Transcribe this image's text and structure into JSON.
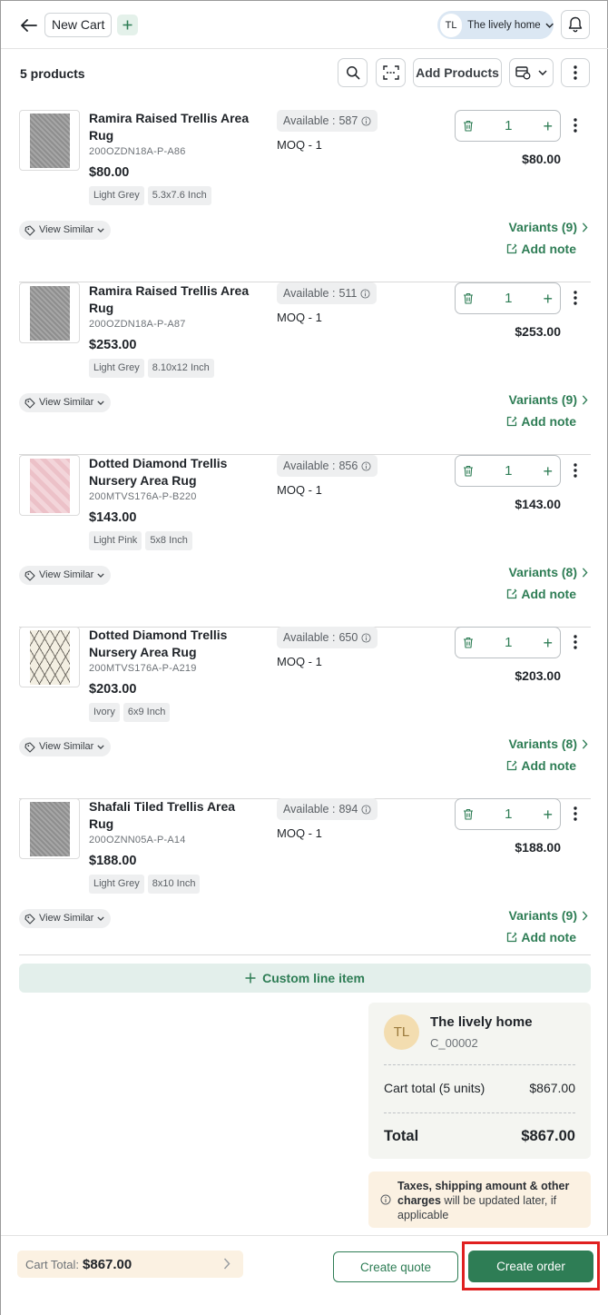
{
  "header": {
    "cart_name": "New Cart",
    "add_icon": "plus-icon",
    "customer_initials": "TL",
    "customer_name": "The lively home"
  },
  "toolbar": {
    "product_count": "5 products",
    "add_products_label": "Add Products"
  },
  "products": [
    {
      "name": "Ramira Raised Trellis Area Rug",
      "sku": "200OZDN18A-P-A86",
      "price": "$80.00",
      "tags": [
        "Light Grey",
        "5.3x7.6 Inch"
      ],
      "available_label": "Available :",
      "available_qty": "587",
      "moq": "MOQ - 1",
      "quantity": "1",
      "line_total": "$80.00",
      "view_similar": "View Similar",
      "variants": "Variants (9)",
      "add_note": "Add note",
      "image_color": "grey"
    },
    {
      "name": "Ramira Raised Trellis Area Rug",
      "sku": "200OZDN18A-P-A87",
      "price": "$253.00",
      "tags": [
        "Light Grey",
        "8.10x12 Inch"
      ],
      "available_label": "Available :",
      "available_qty": "511",
      "moq": "MOQ - 1",
      "quantity": "1",
      "line_total": "$253.00",
      "view_similar": "View Similar",
      "variants": "Variants (9)",
      "add_note": "Add note",
      "image_color": "grey"
    },
    {
      "name": "Dotted Diamond Trellis Nursery Area Rug",
      "sku": "200MTVS176A-P-B220",
      "price": "$143.00",
      "tags": [
        "Light Pink",
        "5x8 Inch"
      ],
      "available_label": "Available :",
      "available_qty": "856",
      "moq": "MOQ - 1",
      "quantity": "1",
      "line_total": "$143.00",
      "view_similar": "View Similar",
      "variants": "Variants (8)",
      "add_note": "Add note",
      "image_color": "pink"
    },
    {
      "name": "Dotted Diamond Trellis Nursery Area Rug",
      "sku": "200MTVS176A-P-A219",
      "price": "$203.00",
      "tags": [
        "Ivory",
        "6x9 Inch"
      ],
      "available_label": "Available :",
      "available_qty": "650",
      "moq": "MOQ - 1",
      "quantity": "1",
      "line_total": "$203.00",
      "view_similar": "View Similar",
      "variants": "Variants (8)",
      "add_note": "Add note",
      "image_color": "ivory"
    },
    {
      "name": "Shafali Tiled Trellis Area Rug",
      "sku": "200OZNN05A-P-A14",
      "price": "$188.00",
      "tags": [
        "Light Grey",
        "8x10 Inch"
      ],
      "available_label": "Available :",
      "available_qty": "894",
      "moq": "MOQ - 1",
      "quantity": "1",
      "line_total": "$188.00",
      "view_similar": "View Similar",
      "variants": "Variants (9)",
      "add_note": "Add note",
      "image_color": "grey"
    }
  ],
  "custom_line_item": "Custom line item",
  "summary": {
    "initials": "TL",
    "customer_name": "The lively home",
    "customer_id": "C_00002",
    "cart_total_label": "Cart total (5 units)",
    "cart_total_value": "$867.00",
    "total_label": "Total",
    "total_value": "$867.00"
  },
  "tax_note": {
    "bold": "Taxes, shipping amount & other charges",
    "rest": " will be updated later, if applicable"
  },
  "footer": {
    "cart_total_label": "Cart Total:",
    "cart_total_value": "$867.00",
    "create_quote": "Create quote",
    "create_order": "Create order"
  },
  "colors": {
    "accent": "#2e7d55",
    "highlight": "#e02020",
    "customer_chip": "#dbe7f3"
  }
}
